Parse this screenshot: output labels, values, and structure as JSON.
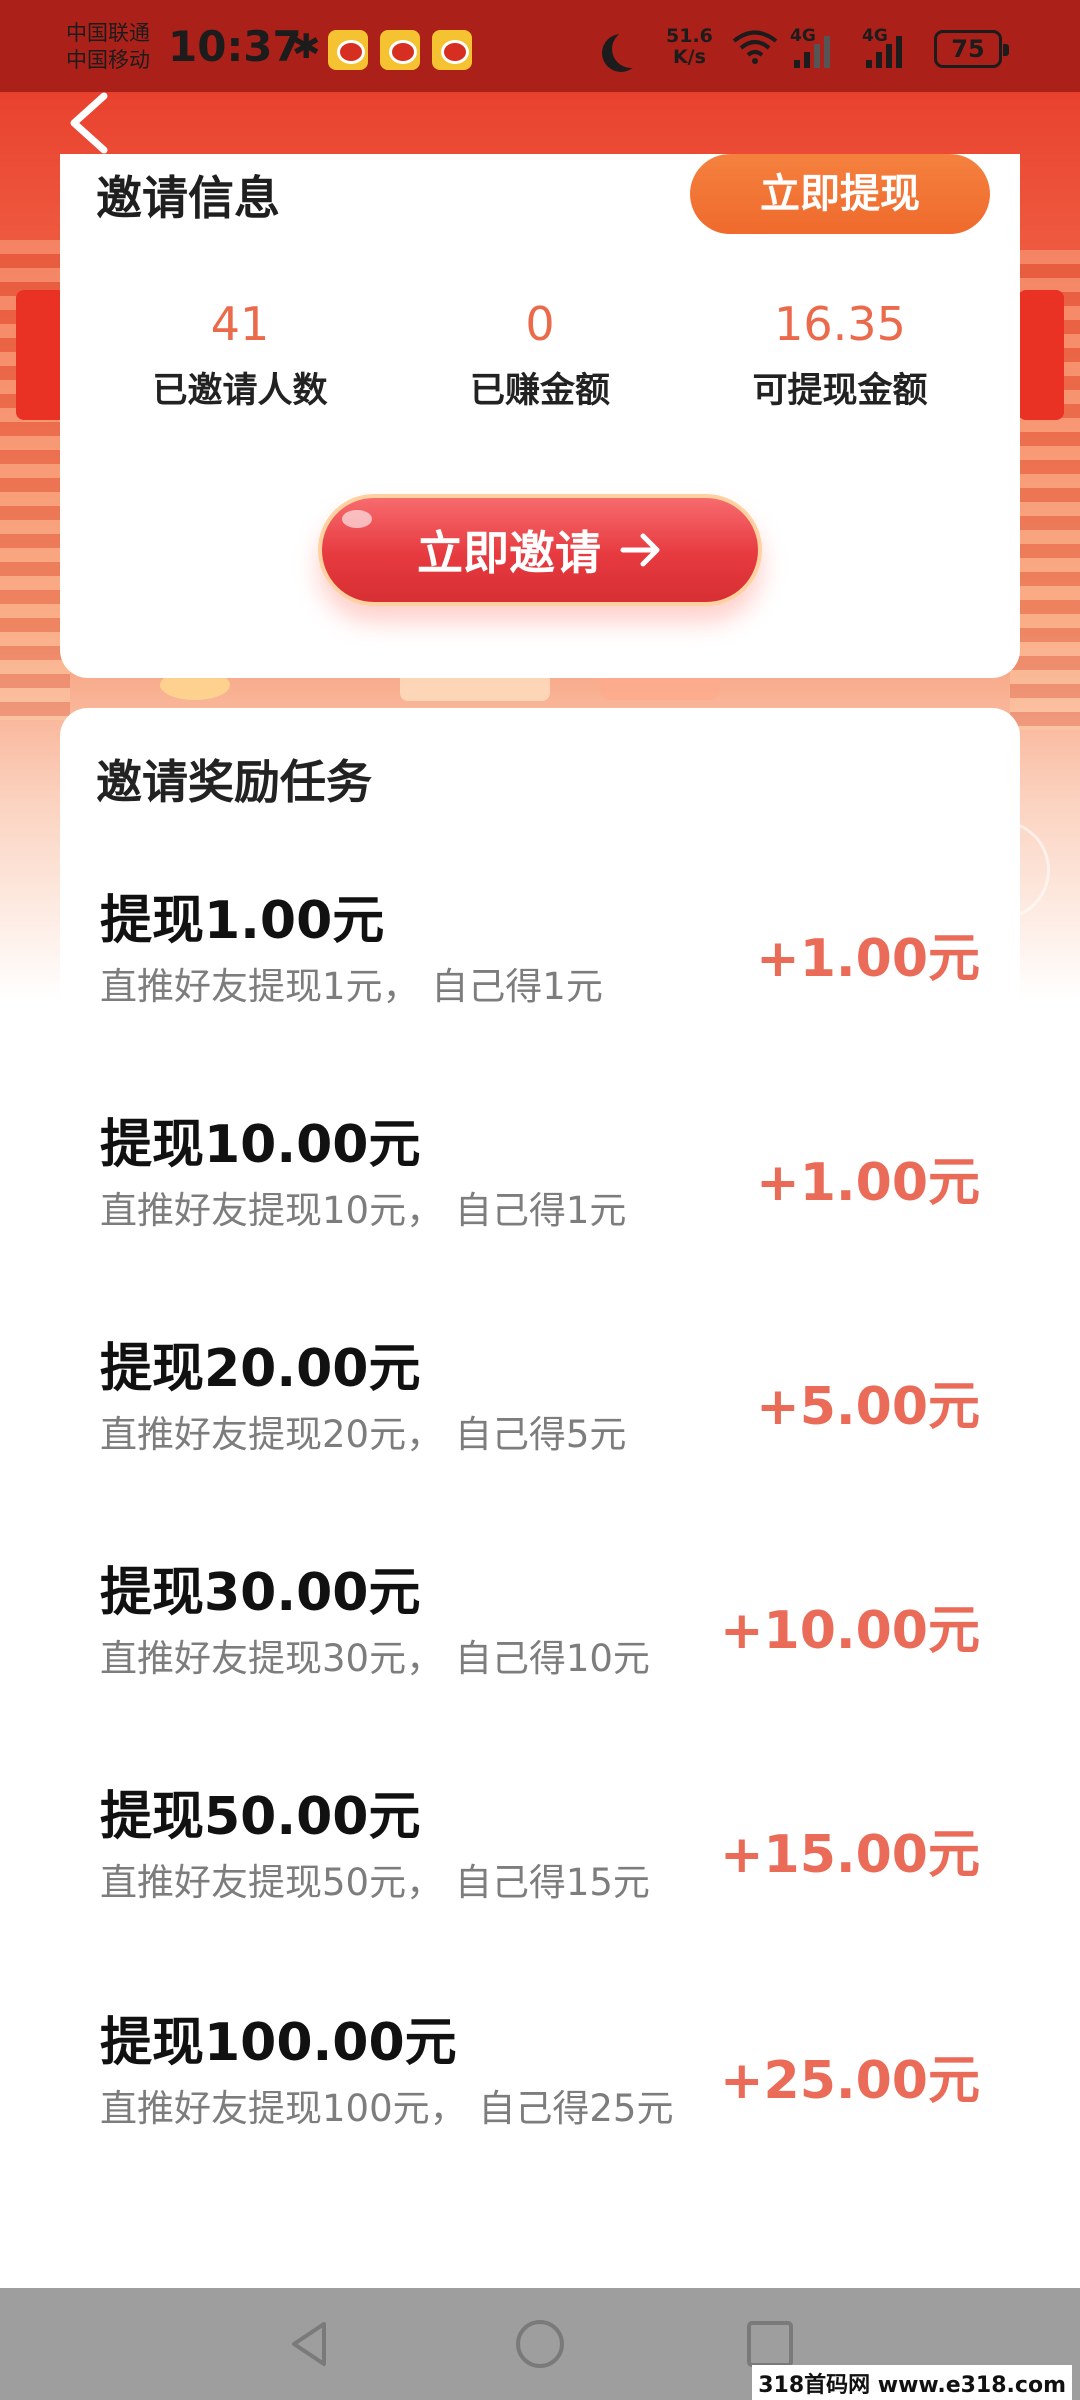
{
  "status_bar": {
    "carrier_1": "中国联通",
    "carrier_2": "中国移动",
    "time": "10:37",
    "net_speed_value": "51.6",
    "net_speed_unit": "K/s",
    "network_1": "4G",
    "network_2": "4G",
    "battery": "75",
    "icons": [
      "bluetooth-icon",
      "weibo-icon",
      "weibo-icon",
      "weibo-icon",
      "moon-icon",
      "wifi-icon",
      "signal-icon",
      "signal-icon",
      "battery-icon"
    ]
  },
  "header": {
    "back_icon": "chevron-left-icon"
  },
  "invite_info": {
    "title": "邀请信息",
    "withdraw_button": "立即提现",
    "stats": [
      {
        "value": "41",
        "label": "已邀请人数"
      },
      {
        "value": "0",
        "label": "已赚金额"
      },
      {
        "value": "16.35",
        "label": "可提现金额"
      }
    ],
    "invite_button": "立即邀请",
    "invite_button_icon": "arrow-right-icon"
  },
  "reward_tasks": {
    "title": "邀请奖励任务",
    "items": [
      {
        "title": "提现1.00元",
        "desc": "直推好友提现1元， 自己得1元",
        "reward": "+1.00元"
      },
      {
        "title": "提现10.00元",
        "desc": "直推好友提现10元， 自己得1元",
        "reward": "+1.00元"
      },
      {
        "title": "提现20.00元",
        "desc": "直推好友提现20元， 自己得5元",
        "reward": "+5.00元"
      },
      {
        "title": "提现30.00元",
        "desc": " 直推好友提现30元， 自己得10元",
        "reward": "+10.00元"
      },
      {
        "title": "提现50.00元",
        "desc": "直推好友提现50元， 自己得15元",
        "reward": "+15.00元"
      },
      {
        "title": "提现100.00元",
        "desc": "直推好友提现100元， 自己得25元",
        "reward": "+25.00元"
      }
    ]
  },
  "nav": {
    "back": "triangle-back-icon",
    "home": "circle-home-icon",
    "recents": "square-recents-icon"
  },
  "watermark": "318首码网 www.e318.com",
  "colors": {
    "status_bar": "#ab2019",
    "accent_orange": "#ef6a2c",
    "invite_red": "#e63a3f",
    "stat_value": "#ea6a4b",
    "reward": "#e96b58",
    "nav_bar": "#9e9e9e"
  }
}
